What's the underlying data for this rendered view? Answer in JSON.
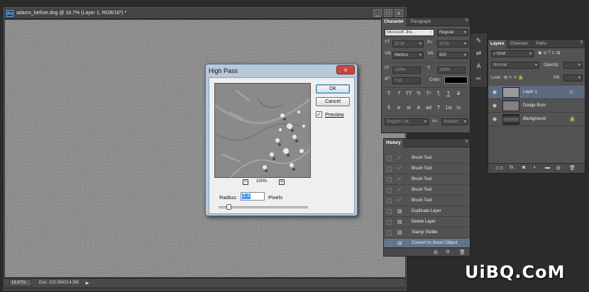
{
  "document": {
    "title": "adams_before.dng @ 16.7% (Layer 1, RGB/16*) *",
    "app_icon": "Ps",
    "window_buttons": [
      "_",
      "□",
      "x"
    ],
    "status": {
      "zoom": "16.67%",
      "doc": "Doc: 102.5M/214.5M"
    }
  },
  "high_pass": {
    "title": "High Pass",
    "close_label": "x",
    "ok_label": "OK",
    "cancel_label": "Cancel",
    "preview_label": "Preview",
    "preview_checked": true,
    "zoom_value": "100%",
    "zoom_out_label": "−",
    "zoom_in_label": "+",
    "radius_label": "Radius:",
    "radius_value": "2.3",
    "radius_unit": "Pixels"
  },
  "character": {
    "tabs": [
      "Character",
      "Paragraph"
    ],
    "font_family": "Microsoft Jhe...",
    "font_style": "Regular",
    "font_size": "22 pt",
    "leading": "10 pt",
    "kerning": "Metrics",
    "tracking": "600",
    "vertical_scale": "100%",
    "horizontal_scale": "100%",
    "baseline_shift": "0 pt",
    "color_label": "Color:",
    "language": "English: UK",
    "antialias": "Smooth",
    "aa_label": "aa",
    "typo_buttons_row1": [
      "T",
      "T",
      "TT",
      "Tr",
      "T¹",
      "T,",
      "T",
      "T"
    ],
    "typo_buttons_row2": [
      "fi",
      "ơ",
      "st",
      "A",
      "ad",
      "T",
      "1st",
      "½"
    ]
  },
  "layers": {
    "tabs": [
      "Layers",
      "Channels",
      "Paths"
    ],
    "filter_kind": "Kind",
    "blend_mode": "Normal",
    "opacity_label": "Opacity:",
    "lock_label": "Lock:",
    "fill_label": "Fill:",
    "items": [
      {
        "name": "Layer 1",
        "selected": true,
        "italic": false
      },
      {
        "name": "Dodge Burn",
        "selected": false,
        "italic": false
      },
      {
        "name": "Background",
        "selected": false,
        "italic": true
      }
    ]
  },
  "history": {
    "title": "History",
    "items": [
      {
        "label": "Brush Tool",
        "icon": "brush-icon"
      },
      {
        "label": "Brush Tool",
        "icon": "brush-icon"
      },
      {
        "label": "Brush Tool",
        "icon": "brush-icon"
      },
      {
        "label": "Brush Tool",
        "icon": "brush-icon"
      },
      {
        "label": "Brush Tool",
        "icon": "brush-icon"
      },
      {
        "label": "Duplicate Layer",
        "icon": "layer-icon"
      },
      {
        "label": "Delete Layer",
        "icon": "layer-icon"
      },
      {
        "label": "Stamp Visible",
        "icon": "layer-icon"
      },
      {
        "label": "Convert to Smart Object",
        "icon": "layer-icon"
      }
    ],
    "selected_index": 8
  },
  "watermark": "UiBQ.CoM"
}
